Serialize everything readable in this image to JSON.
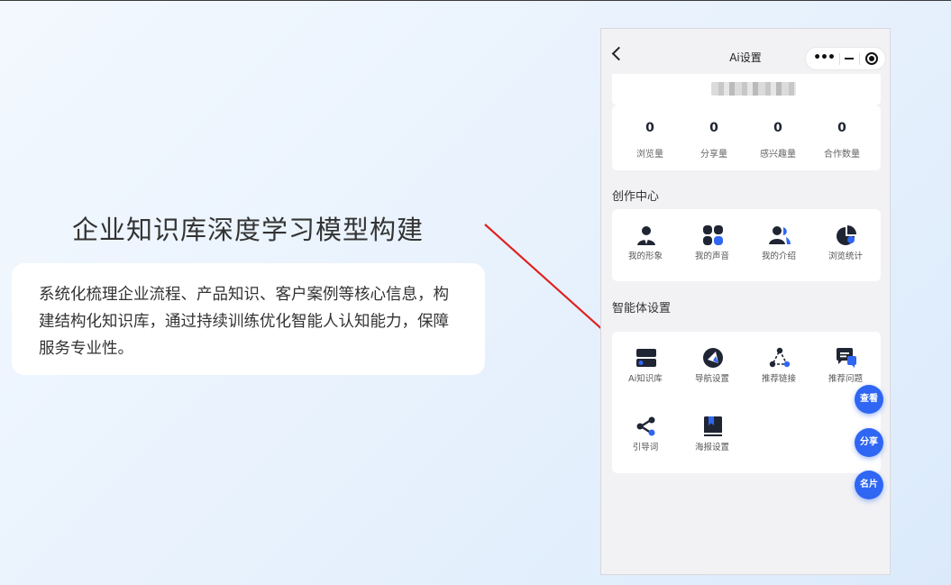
{
  "hero": {
    "title": "企业知识库深度学习模型构建",
    "description": "系统化梳理企业流程、产品知识、客户案例等核心信息，构建结构化知识库，通过持续训练优化智能人认知能力，保障服务专业性。"
  },
  "phone": {
    "nav_title": "Ai设置",
    "capsule_more": "•••",
    "stats": [
      {
        "value": "0",
        "label": "浏览量"
      },
      {
        "value": "0",
        "label": "分享量"
      },
      {
        "value": "0",
        "label": "感兴趣量"
      },
      {
        "value": "0",
        "label": "合作数量"
      }
    ],
    "creation_center": {
      "title": "创作中心",
      "items": [
        {
          "label": "我的形象",
          "icon": "person-icon"
        },
        {
          "label": "我的声音",
          "icon": "voice-icon"
        },
        {
          "label": "我的介绍",
          "icon": "users-icon"
        },
        {
          "label": "浏览统计",
          "icon": "pie-chart-icon"
        }
      ]
    },
    "agent_settings": {
      "title": "智能体设置",
      "items": [
        {
          "label": "Ai知识库",
          "icon": "database-icon"
        },
        {
          "label": "导航设置",
          "icon": "compass-icon"
        },
        {
          "label": "推荐链接",
          "icon": "link-icon"
        },
        {
          "label": "推荐问题",
          "icon": "chat-icon"
        },
        {
          "label": "引导词",
          "icon": "share-icon"
        },
        {
          "label": "海报设置",
          "icon": "poster-icon"
        }
      ]
    },
    "fabs": [
      "查看",
      "分享",
      "名片"
    ],
    "colors": {
      "accent": "#2f66f3",
      "dark_icon": "#1f2533",
      "arrow": "#e02020"
    }
  }
}
